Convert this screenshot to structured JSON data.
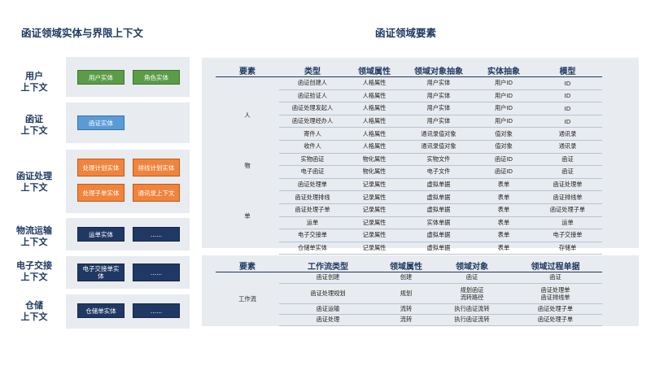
{
  "left_title": "函证领域实体与界限上下文",
  "right_title": "函证领域要素",
  "contexts": [
    {
      "label_line1": "用户",
      "label_line2": "上下文",
      "entities": [
        "用户实体",
        "角色实体"
      ]
    },
    {
      "label_line1": "函证",
      "label_line2": "上下文",
      "entities": [
        "函证实体"
      ]
    },
    {
      "label_line1": "函证处理",
      "label_line2": "上下文",
      "entities": [
        "处理计划实体",
        "排线计划实体",
        "处理子单实体",
        "通讯录上下文"
      ]
    },
    {
      "label_line1": "物流运输",
      "label_line2": "上下文",
      "entities": [
        "运单实体",
        "......"
      ]
    },
    {
      "label_line1": "电子交接",
      "label_line2": "上下文",
      "entities": [
        "电子交接单实体",
        "......"
      ]
    },
    {
      "label_line1": "仓储",
      "label_line2": "上下文",
      "entities": [
        "仓储单实体",
        "......"
      ]
    }
  ],
  "table1": {
    "headers": [
      "要素",
      "类型",
      "领域属性",
      "领域对象抽象",
      "实体抽象",
      "模型"
    ],
    "groups": {
      "person": "人",
      "thing": "物",
      "doc": "单"
    },
    "rows": [
      [
        "函证创建人",
        "人格属性",
        "用户实体",
        "用户ID",
        "ID"
      ],
      [
        "函证验证人",
        "人格属性",
        "用户实体",
        "用户ID",
        "ID"
      ],
      [
        "函证处理发起人",
        "人格属性",
        "用户实体",
        "用户ID",
        "ID"
      ],
      [
        "函证处理经办人",
        "人格属性",
        "用户实体",
        "用户ID",
        "ID"
      ],
      [
        "寄件人",
        "人格属性",
        "通讯录值对象",
        "值对象",
        "通讯录"
      ],
      [
        "收件人",
        "人格属性",
        "通讯录值对象",
        "值对象",
        "通讯录"
      ],
      [
        "实物函证",
        "物化属性",
        "实物文件",
        "函证ID",
        "函证"
      ],
      [
        "电子函证",
        "物化属性",
        "电子文件",
        "函证ID",
        "函证"
      ],
      [
        "函证处理单",
        "记录属性",
        "虚拟单据",
        "表单",
        "函证处理单"
      ],
      [
        "函证处理排线",
        "记录属性",
        "虚拟单据",
        "表单",
        "函证排线单"
      ],
      [
        "函证处理子单",
        "记录属性",
        "虚拟单据",
        "表单",
        "函证处理子单"
      ],
      [
        "运单",
        "记录属性",
        "实体单据",
        "表单",
        "运单"
      ],
      [
        "电子交接单",
        "记录属性",
        "虚拟单据",
        "表单",
        "电子交接单"
      ],
      [
        "仓储单实体",
        "记录属性",
        "虚拟单据",
        "表单",
        "存储单"
      ]
    ]
  },
  "table2": {
    "headers": [
      "要素",
      "工作流类型",
      "领域属性",
      "领域对象",
      "领域过程单据"
    ],
    "group": "工作流",
    "rows": [
      {
        "type": "函证创建",
        "attr": "创建",
        "obj1": "函证",
        "obj2": "",
        "doc1": "函证",
        "doc2": ""
      },
      {
        "type": "函证处理规划",
        "attr": "规划",
        "obj1": "规划函证",
        "obj2": "流转路径",
        "doc1": "函证处理单",
        "doc2": "函证排线单"
      },
      {
        "type": "函证运输",
        "attr": "流转",
        "obj1": "执行函证流转",
        "obj2": "",
        "doc1": "函证处理子单",
        "doc2": ""
      },
      {
        "type": "函证处理",
        "attr": "流转",
        "obj1": "执行函证流转",
        "obj2": "",
        "doc1": "函证处理子单",
        "doc2": ""
      }
    ]
  },
  "colors": {
    "title": "#1f3a63",
    "green": "#5b9c47",
    "blue": "#5b9bd5",
    "orange": "#f0843c",
    "navy": "#203864",
    "panel": "#e8ebef"
  }
}
